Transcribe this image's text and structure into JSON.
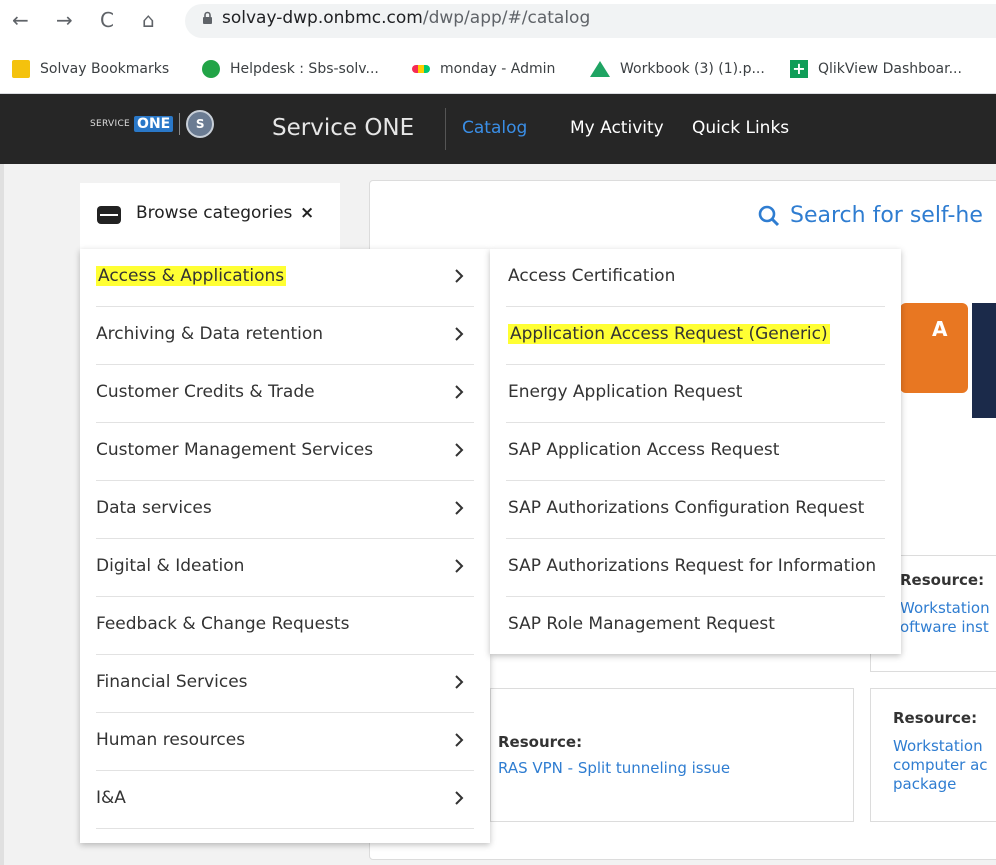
{
  "browser": {
    "url_host": "solvay-dwp.onbmc.com",
    "url_path": "/dwp/app/#/catalog",
    "bookmarks": [
      {
        "label": "Solvay Bookmarks",
        "icon": "folder-icon"
      },
      {
        "label": "Helpdesk : Sbs-solv...",
        "icon": "headset-icon"
      },
      {
        "label": "monday - Admin",
        "icon": "monday-icon"
      },
      {
        "label": "Workbook (3) (1).p...",
        "icon": "drive-icon"
      },
      {
        "label": "QlikView Dashboar...",
        "icon": "plus-icon"
      }
    ]
  },
  "header": {
    "logo_service": "SERVICE",
    "logo_one": "ONE",
    "logo_mark": "S",
    "app_title": "Service ONE",
    "nav": [
      {
        "label": "Catalog",
        "active": true
      },
      {
        "label": "My Activity",
        "active": false
      },
      {
        "label": "Quick Links",
        "active": false
      }
    ]
  },
  "search": {
    "label": "Search for self-he"
  },
  "browse": {
    "tab_label": "Browse categories",
    "close": "×",
    "categories": [
      {
        "label": "Access & Applications",
        "has_children": true,
        "highlighted": true
      },
      {
        "label": "Archiving & Data retention",
        "has_children": true
      },
      {
        "label": "Customer Credits & Trade",
        "has_children": true
      },
      {
        "label": "Customer Management Services",
        "has_children": true
      },
      {
        "label": "Data services",
        "has_children": true
      },
      {
        "label": "Digital & Ideation",
        "has_children": true
      },
      {
        "label": "Feedback & Change Requests",
        "has_children": false
      },
      {
        "label": "Financial Services",
        "has_children": true
      },
      {
        "label": "Human resources",
        "has_children": true
      },
      {
        "label": "I&A",
        "has_children": true
      }
    ],
    "subcategories": [
      {
        "label": "Access Certification"
      },
      {
        "label": "Application Access Request (Generic)",
        "highlighted": true
      },
      {
        "label": "Energy Application Request"
      },
      {
        "label": "SAP Application Access Request"
      },
      {
        "label": "SAP Authorizations Configuration Request"
      },
      {
        "label": "SAP Authorizations Request for Information"
      },
      {
        "label": "SAP Role Management Request"
      }
    ]
  },
  "banner": {
    "letter": "A"
  },
  "resources": {
    "card1": {
      "label": "Resource:",
      "lines": [
        "Workstation",
        "oftware inst"
      ]
    },
    "card2": {
      "label": "Resource:",
      "lines": [
        "RAS VPN - Split tunneling issue"
      ]
    },
    "card3": {
      "label": "Resource:",
      "lines": [
        "Workstation",
        "computer ac",
        "package"
      ]
    }
  },
  "colors": {
    "accent": "#2f7dd1",
    "header_bg": "#262626",
    "highlight": "#ffff33"
  }
}
